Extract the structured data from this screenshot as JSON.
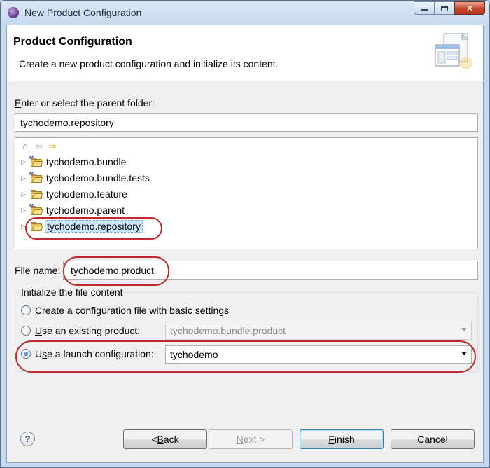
{
  "window": {
    "title": "New Product Configuration",
    "controls": {
      "minimize": "minimize",
      "maximize": "maximize",
      "close": "✕"
    }
  },
  "header": {
    "title": "Product Configuration",
    "description": "Create a new product configuration and initialize its content."
  },
  "parent_folder": {
    "label_mnemonic": "E",
    "label_rest": "nter or select the parent folder:",
    "value": "tychodemo.repository"
  },
  "tree": {
    "toolbar": {
      "home": "⌂",
      "back": "⇦",
      "forward": "⇨"
    },
    "items": [
      {
        "label": "tychodemo.bundle",
        "badge": "M"
      },
      {
        "label": "tychodemo.bundle.tests",
        "badge": "M"
      },
      {
        "label": "tychodemo.feature",
        "badge": ""
      },
      {
        "label": "tychodemo.parent",
        "badge": "M"
      },
      {
        "label": "tychodemo.repository",
        "badge": "",
        "selected": true
      }
    ]
  },
  "file_name": {
    "label_pre": "File na",
    "label_mnemonic": "m",
    "label_post": "e:",
    "value": "tychodemo.product"
  },
  "init_group": {
    "title": "Initialize the file content",
    "options": [
      {
        "mnemonic": "C",
        "rest": "reate a configuration file with basic settings",
        "checked": false
      },
      {
        "mnemonic": "U",
        "rest": "se an existing product:",
        "checked": false,
        "combo_value": "tychodemo.bundle.product",
        "combo_enabled": false
      },
      {
        "mnemonic": "s",
        "pre": "U",
        "rest": "e a launch configuration:",
        "checked": true,
        "combo_value": "tychodemo",
        "combo_enabled": true
      }
    ]
  },
  "buttons": {
    "help": "?",
    "back": {
      "pre": "< ",
      "mnemonic": "B",
      "rest": "ack"
    },
    "next": {
      "pre": "",
      "mnemonic": "N",
      "rest": "ext >"
    },
    "finish": {
      "pre": "",
      "mnemonic": "F",
      "rest": "inish"
    },
    "cancel": "Cancel"
  },
  "colors": {
    "annotation": "#c0282d",
    "selection": "#cde8ff"
  }
}
